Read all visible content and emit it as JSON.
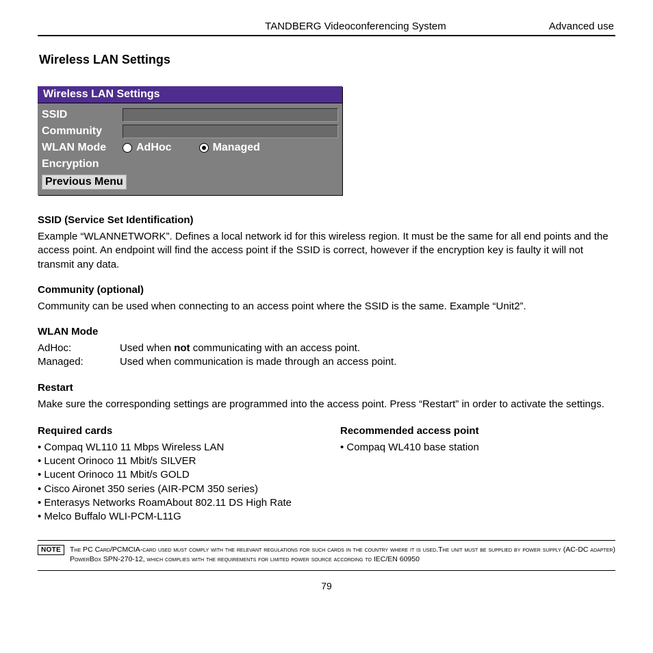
{
  "header": {
    "center": "TANDBERG Videoconferencing System",
    "right": "Advanced use"
  },
  "title": "Wireless LAN Settings",
  "panel": {
    "header": "Wireless LAN Settings",
    "ssid_label": "SSID",
    "community_label": "Community",
    "wlan_mode_label": "WLAN Mode",
    "adhoc_label": "AdHoc",
    "managed_label": "Managed",
    "encryption_label": "Encryption",
    "previous_menu": "Previous Menu"
  },
  "sections": {
    "ssid_head": "SSID (Service Set Identification)",
    "ssid_body": "Example “WLANNETWORK”. Defines a local network id for this wireless region. It must be the same for all end points and the access point. An endpoint will find the access point if the SSID is correct, however if the encryption key is faulty it will not transmit any data.",
    "community_head": "Community (optional)",
    "community_body": "Community can be used when connecting to an access point where the SSID is the same. Example “Unit2”.",
    "wlan_head": "WLAN Mode",
    "wlan_adhoc_label": "AdHoc:",
    "wlan_adhoc_pre": "Used when ",
    "wlan_adhoc_bold": "not",
    "wlan_adhoc_post": " communicating with an access point.",
    "wlan_managed_label": "Managed:",
    "wlan_managed_desc": "Used when communication is made through an access point.",
    "restart_head": "Restart",
    "restart_body": "Make sure the corresponding settings are programmed into the access point. Press “Restart” in order to activate the settings.",
    "required_head": "Required cards",
    "required_items": [
      "Compaq WL110 11 Mbps Wireless LAN",
      "Lucent Orinoco 11 Mbit/s SILVER",
      "Lucent Orinoco 11 Mbit/s GOLD",
      "Cisco Aironet 350 series (AIR-PCM 350 series)",
      "Enterasys Networks RoamAbout 802.11 DS High Rate",
      "Melco Buffalo WLI-PCM-L11G"
    ],
    "recommended_head": "Recommended access point",
    "recommended_items": [
      "Compaq WL410 base station"
    ]
  },
  "note": {
    "badge": "NOTE",
    "text": "The PC Card/PCMCIA-card used must comply with the relevant regulations for such cards in the country where it is used.The unit must be supplied by power supply (AC-DC adapter) PowerBox SPN-270-12, which complies with the requirements for limited power source according to IEC/EN 60950"
  },
  "page_number": "79"
}
